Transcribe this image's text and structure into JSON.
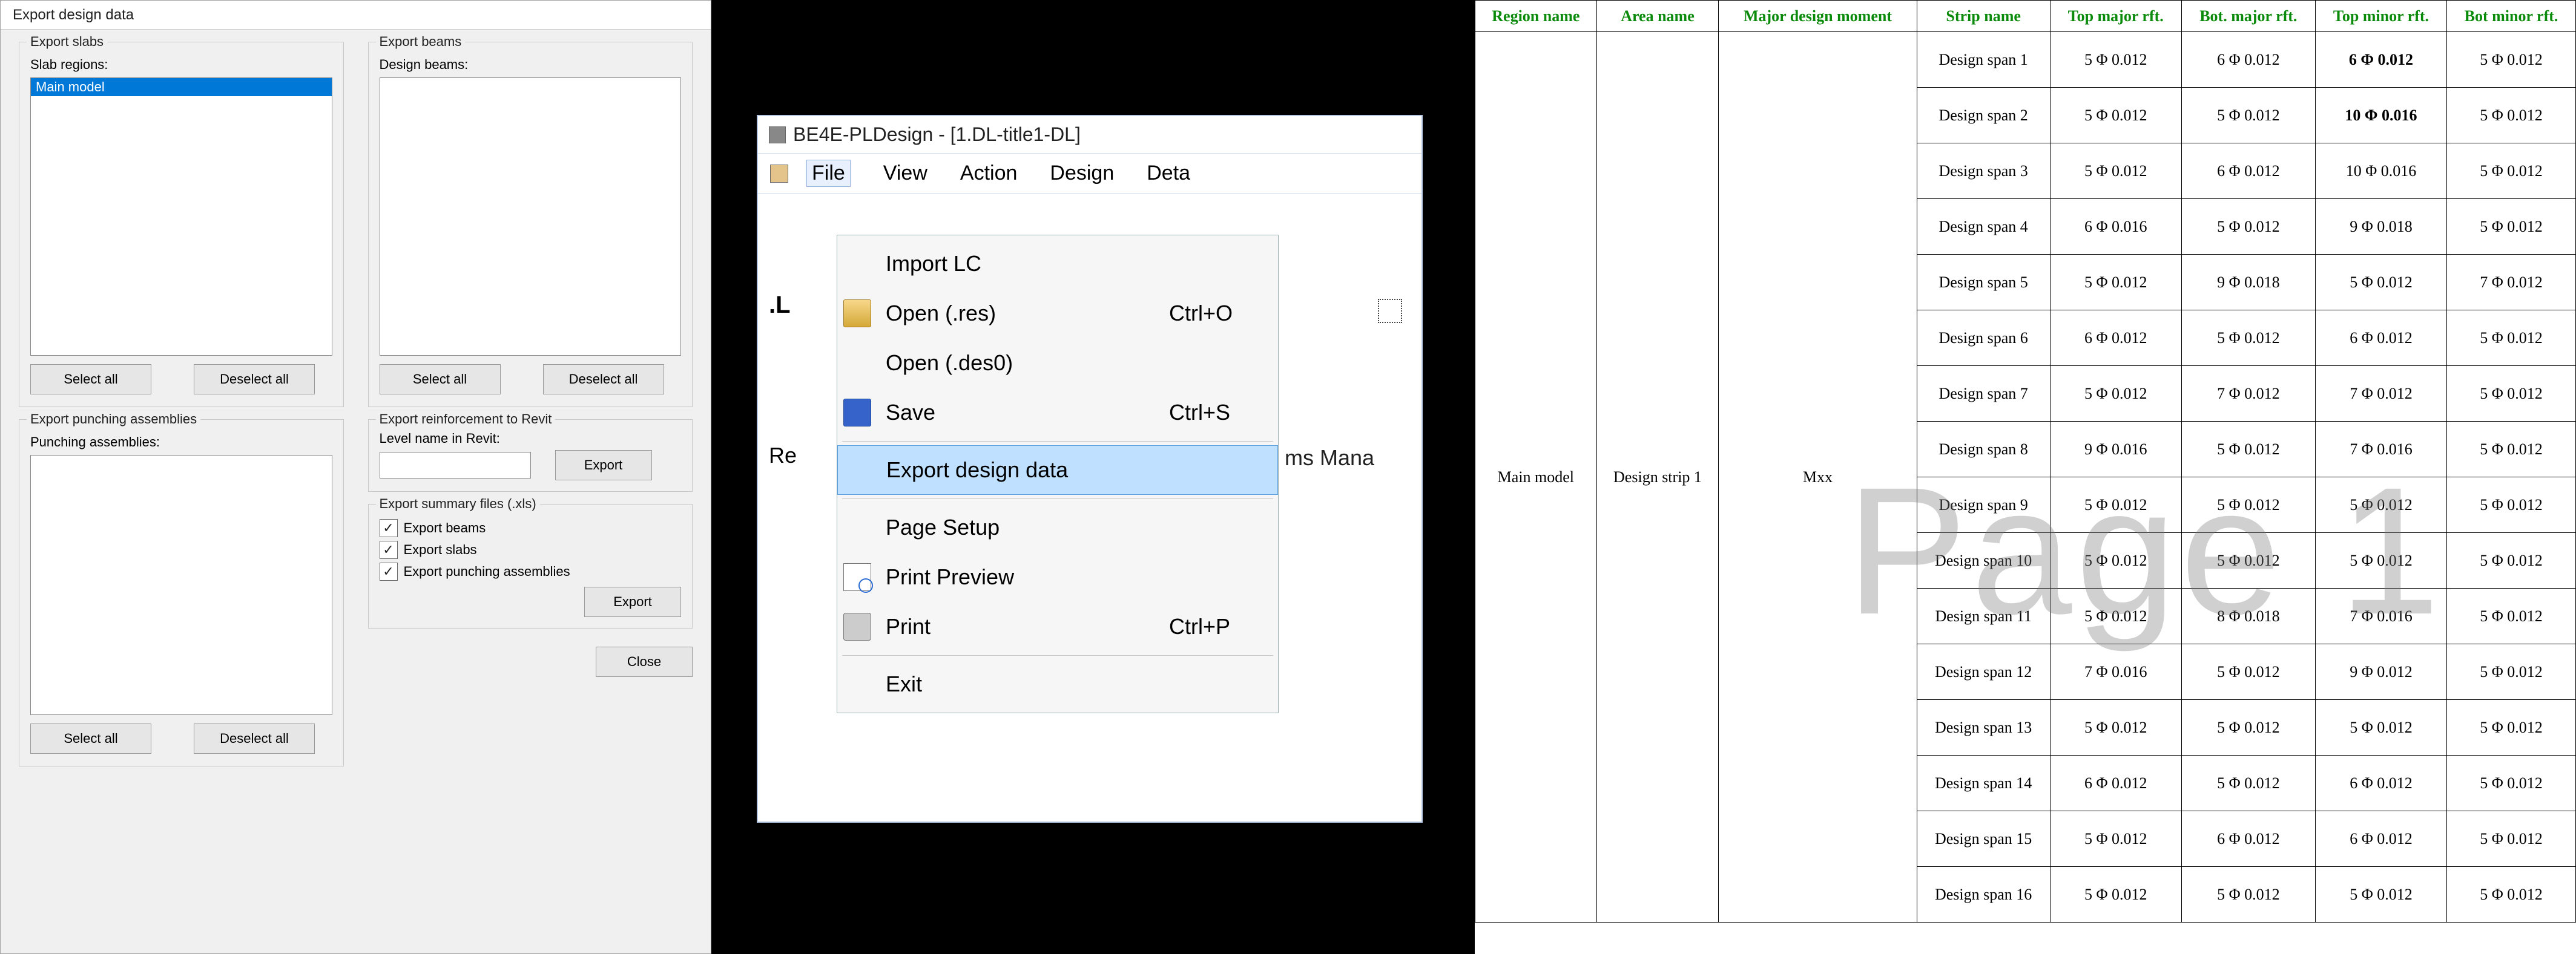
{
  "dialog": {
    "title": "Export design data",
    "slabs": {
      "legend": "Export slabs",
      "label": "Slab regions:",
      "items": [
        "Main model"
      ],
      "select_all": "Select all",
      "deselect_all": "Deselect all"
    },
    "beams": {
      "legend": "Export beams",
      "label": "Design beams:",
      "select_all": "Select all",
      "deselect_all": "Deselect all"
    },
    "punch": {
      "legend": "Export punching assemblies",
      "label": "Punching assemblies:",
      "select_all": "Select all",
      "deselect_all": "Deselect all"
    },
    "revit": {
      "legend": "Export reinforcement to Revit",
      "label": "Level name in Revit:",
      "value": "",
      "export": "Export"
    },
    "summary": {
      "legend": "Export summary files (.xls)",
      "chk_beams": "Export beams",
      "chk_slabs": "Export slabs",
      "chk_punch": "Export punching assemblies",
      "export": "Export"
    },
    "close": "Close"
  },
  "appwin": {
    "title": "BE4E-PLDesign - [1.DL-title1-DL]",
    "menus": {
      "file": "File",
      "view": "View",
      "action": "Action",
      "design": "Design",
      "deta": "Deta"
    },
    "file_items": {
      "import_lc": "Import LC",
      "open_res": "Open (.res)",
      "open_res_sc": "Ctrl+O",
      "open_des0": "Open (.des0)",
      "save": "Save",
      "save_sc": "Ctrl+S",
      "export_dd": "Export design data",
      "page_setup": "Page Setup",
      "print_preview": "Print Preview",
      "print": "Print",
      "print_sc": "Ctrl+P",
      "exit": "Exit"
    },
    "behind": {
      "ms_mana": "ms Mana"
    },
    "lt_label": ".L",
    "re_label": "Re"
  },
  "table": {
    "watermark": "Page 1",
    "headers": [
      "Region name",
      "Area name",
      "Major design moment",
      "Strip name",
      "Top major rft.",
      "Bot. major rft.",
      "Top minor rft.",
      "Bot minor rft."
    ],
    "region": "Main model",
    "area": "Design strip 1",
    "moment": "Mxx",
    "rows": [
      {
        "strip": "Design span 1",
        "tmaj": "5 Φ 0.012",
        "bmaj": "6 Φ 0.012",
        "tmin": "6 Φ 0.012",
        "bmin": "5 Φ 0.012",
        "tmin_hl": true
      },
      {
        "strip": "Design span 2",
        "tmaj": "5 Φ 0.012",
        "bmaj": "5 Φ 0.012",
        "tmin": "10 Φ 0.016",
        "bmin": "5 Φ 0.012",
        "tmin_hl": true
      },
      {
        "strip": "Design span 3",
        "tmaj": "5 Φ 0.012",
        "bmaj": "6 Φ 0.012",
        "tmin": "10 Φ 0.016",
        "bmin": "5 Φ 0.012"
      },
      {
        "strip": "Design span 4",
        "tmaj": "6 Φ 0.016",
        "bmaj": "5 Φ 0.012",
        "tmin": "9 Φ 0.018",
        "bmin": "5 Φ 0.012"
      },
      {
        "strip": "Design span 5",
        "tmaj": "5 Φ 0.012",
        "bmaj": "9 Φ 0.018",
        "tmin": "5 Φ 0.012",
        "bmin": "7 Φ 0.012"
      },
      {
        "strip": "Design span 6",
        "tmaj": "6 Φ 0.012",
        "bmaj": "5 Φ 0.012",
        "tmin": "6 Φ 0.012",
        "bmin": "5 Φ 0.012"
      },
      {
        "strip": "Design span 7",
        "tmaj": "5 Φ 0.012",
        "bmaj": "7 Φ 0.012",
        "tmin": "7 Φ 0.012",
        "bmin": "5 Φ 0.012"
      },
      {
        "strip": "Design span 8",
        "tmaj": "9 Φ 0.016",
        "bmaj": "5 Φ 0.012",
        "tmin": "7 Φ 0.016",
        "bmin": "5 Φ 0.012"
      },
      {
        "strip": "Design span 9",
        "tmaj": "5 Φ 0.012",
        "bmaj": "5 Φ 0.012",
        "tmin": "5 Φ 0.012",
        "bmin": "5 Φ 0.012"
      },
      {
        "strip": "Design span 10",
        "tmaj": "5 Φ 0.012",
        "bmaj": "5 Φ 0.012",
        "tmin": "5 Φ 0.012",
        "bmin": "5 Φ 0.012"
      },
      {
        "strip": "Design span 11",
        "tmaj": "5 Φ 0.012",
        "bmaj": "8 Φ 0.018",
        "tmin": "7 Φ 0.016",
        "bmin": "5 Φ 0.012"
      },
      {
        "strip": "Design span 12",
        "tmaj": "7 Φ 0.016",
        "bmaj": "5 Φ 0.012",
        "tmin": "9 Φ 0.012",
        "bmin": "5 Φ 0.012"
      },
      {
        "strip": "Design span 13",
        "tmaj": "5 Φ 0.012",
        "bmaj": "5 Φ 0.012",
        "tmin": "5 Φ 0.012",
        "bmin": "5 Φ 0.012"
      },
      {
        "strip": "Design span 14",
        "tmaj": "6 Φ 0.012",
        "bmaj": "5 Φ 0.012",
        "tmin": "6 Φ 0.012",
        "bmin": "5 Φ 0.012"
      },
      {
        "strip": "Design span 15",
        "tmaj": "5 Φ 0.012",
        "bmaj": "6 Φ 0.012",
        "tmin": "6 Φ 0.012",
        "bmin": "5 Φ 0.012"
      },
      {
        "strip": "Design span 16",
        "tmaj": "5 Φ 0.012",
        "bmaj": "5 Φ 0.012",
        "tmin": "5 Φ 0.012",
        "bmin": "5 Φ 0.012"
      }
    ]
  }
}
